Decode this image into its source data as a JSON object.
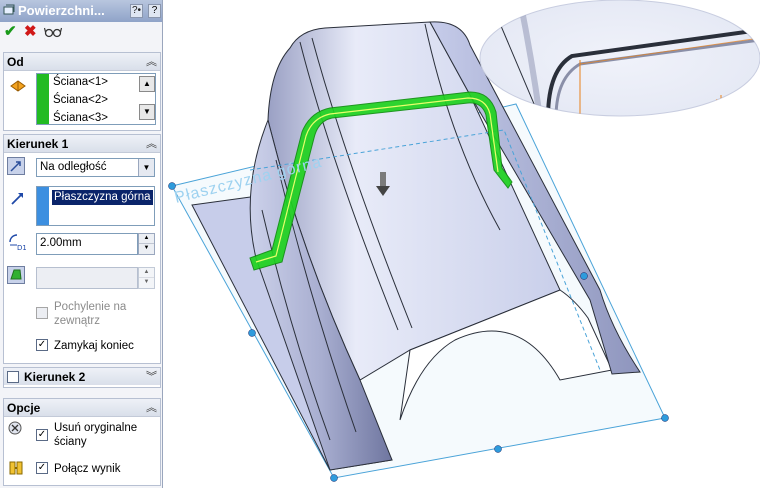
{
  "title": "Powierzchni...",
  "title_buttons": {
    "help": "?•",
    "question": "?"
  },
  "actions": {
    "ok_icon": "check-icon",
    "cancel_icon": "x-icon",
    "preview_icon": "glasses-icon"
  },
  "od": {
    "label": "Od",
    "items": [
      "Ściana<1>",
      "Ściana<2>",
      "Ściana<3>"
    ]
  },
  "kierunek1": {
    "label": "Kierunek 1",
    "end_condition": "Na odległość",
    "reference": "Płaszczyzna górna",
    "distance": "2.00mm",
    "draft_label": "Pochylenie na zewnątrz",
    "draft_line1": "Pochylenie na",
    "draft_line2": "zewnątrz",
    "cap_label": "Zamykaj koniec",
    "cap_checked": true,
    "draft_checked": false
  },
  "kierunek2": {
    "label": "Kierunek 2",
    "checked": false
  },
  "opcje": {
    "label": "Opcje",
    "delete_line1": "Usuń oryginalne",
    "delete_line2": "ściany",
    "delete_checked": true,
    "merge_label": "Połącz wynik",
    "merge_checked": true
  },
  "viewport": {
    "plane_label": "Płaszczyzna górna",
    "colors": {
      "face": "#c9cfea",
      "edge": "#2a2f3a",
      "highlight": "#1fd21f",
      "plane": "#4aa3d8",
      "sketch": "#e8801a"
    }
  }
}
